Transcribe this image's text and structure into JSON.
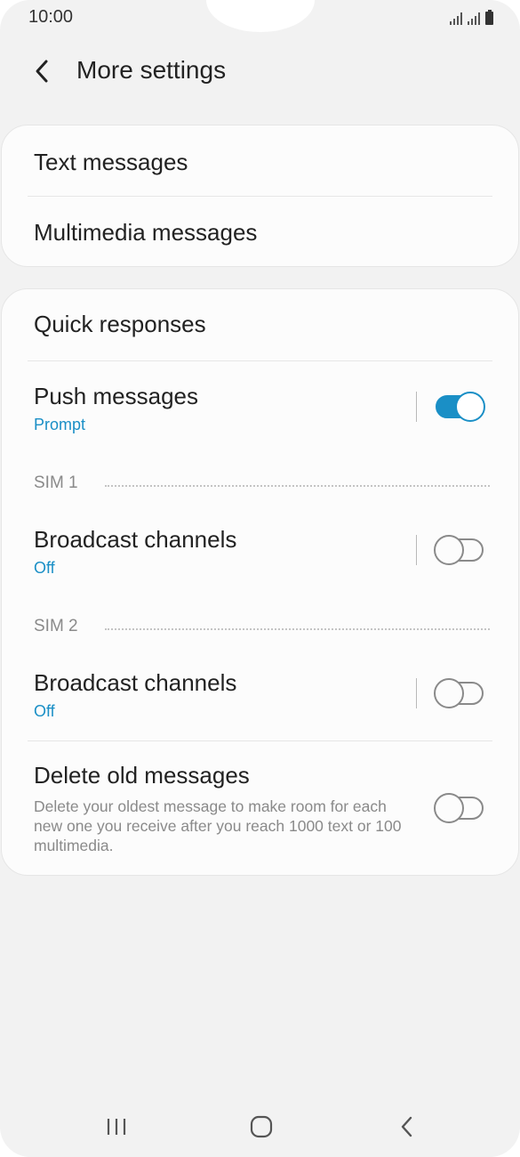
{
  "status_bar": {
    "time": "10:00"
  },
  "header": {
    "title": "More settings",
    "back_icon": "chevron-left-icon"
  },
  "group1": {
    "items": [
      {
        "label": "Text messages"
      },
      {
        "label": "Multimedia messages"
      }
    ]
  },
  "group2": {
    "quick_responses": "Quick responses",
    "push_messages": {
      "title": "Push messages",
      "subtitle": "Prompt",
      "enabled": true
    },
    "sim1": {
      "header": "SIM 1",
      "broadcast": {
        "title": "Broadcast channels",
        "subtitle": "Off",
        "enabled": false
      }
    },
    "sim2": {
      "header": "SIM 2",
      "broadcast": {
        "title": "Broadcast channels",
        "subtitle": "Off",
        "enabled": false
      }
    },
    "delete_old": {
      "title": "Delete old messages",
      "description": "Delete your oldest message to make room for each new one you receive after you reach 1000 text or 100 multimedia.",
      "enabled": false
    }
  },
  "nav_bar": {
    "icons": [
      "recent-apps-icon",
      "home-icon",
      "back-icon"
    ]
  },
  "colors": {
    "accent": "#1a8fc6",
    "background": "#f2f2f2",
    "card": "#fcfcfc"
  }
}
